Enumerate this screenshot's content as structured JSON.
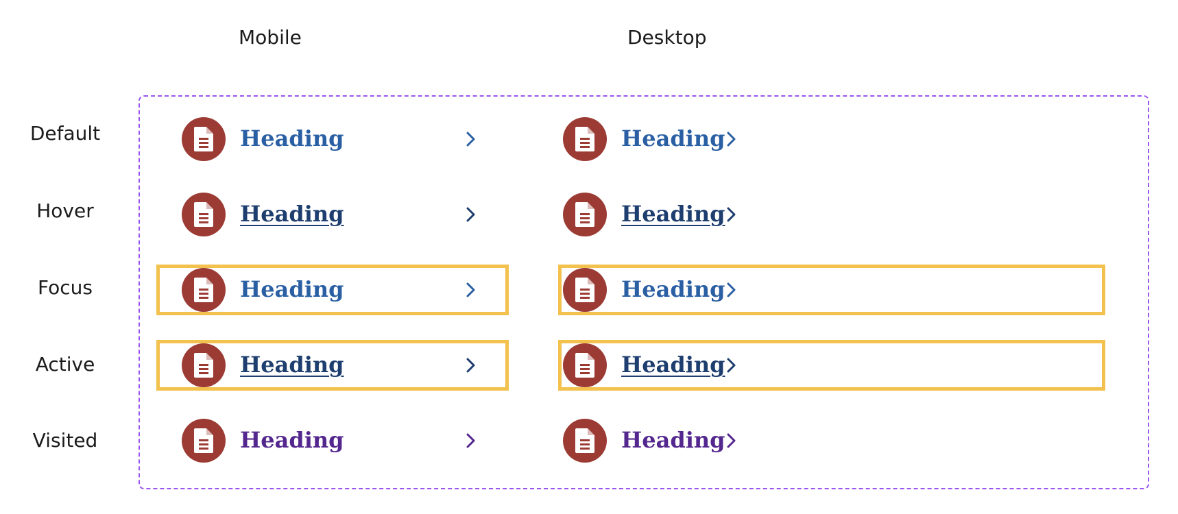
{
  "columns": {
    "mobile": "Mobile",
    "desktop": "Desktop"
  },
  "states": [
    {
      "label": "Default",
      "heading": "Heading",
      "color": "#2a5fa3",
      "underline": false,
      "focus_ring": false
    },
    {
      "label": "Hover",
      "heading": "Heading",
      "color": "#1d3e6e",
      "underline": true,
      "focus_ring": false
    },
    {
      "label": "Focus",
      "heading": "Heading",
      "color": "#2a5fa3",
      "underline": false,
      "focus_ring": true
    },
    {
      "label": "Active",
      "heading": "Heading",
      "color": "#1d3e6e",
      "underline": true,
      "focus_ring": true
    },
    {
      "label": "Visited",
      "heading": "Heading",
      "color": "#54278f",
      "underline": false,
      "focus_ring": false
    }
  ],
  "colors": {
    "icon_bg": "#9b3b34",
    "focus_ring": "#f2c14e",
    "frame": "#9955ee"
  },
  "icon": "document-icon"
}
